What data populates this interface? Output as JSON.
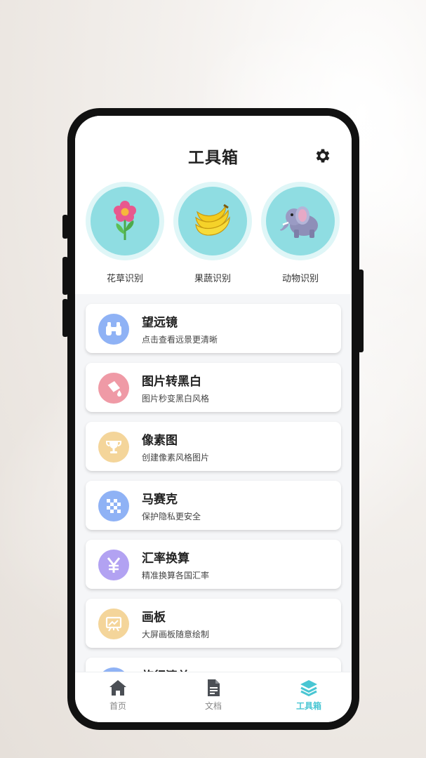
{
  "header": {
    "title": "工具箱"
  },
  "recognition": [
    {
      "label": "花草识别",
      "icon": "flower-icon"
    },
    {
      "label": "果蔬识别",
      "icon": "banana-icon"
    },
    {
      "label": "动物识别",
      "icon": "elephant-icon"
    }
  ],
  "tools": [
    {
      "title": "望远镜",
      "subtitle": "点击查看远景更清晰",
      "icon": "binoculars-icon",
      "color": "#8fb2f5"
    },
    {
      "title": "图片转黑白",
      "subtitle": "图片秒变黑白风格",
      "icon": "paint-bucket-icon",
      "color": "#ef9aa6"
    },
    {
      "title": "像素图",
      "subtitle": "创建像素风格图片",
      "icon": "trophy-icon",
      "color": "#f4d59a"
    },
    {
      "title": "马赛克",
      "subtitle": "保护隐私更安全",
      "icon": "mosaic-icon",
      "color": "#8fb2f5"
    },
    {
      "title": "汇率换算",
      "subtitle": "精准换算各国汇率",
      "icon": "yen-icon",
      "color": "#b2a2f2"
    },
    {
      "title": "画板",
      "subtitle": "大屏画板随意绘制",
      "icon": "easel-icon",
      "color": "#f4d59a"
    },
    {
      "title": "旅行清单",
      "subtitle": "",
      "icon": "checklist-icon",
      "color": "#8fb2f5"
    }
  ],
  "tabbar": [
    {
      "label": "首页",
      "icon": "home-icon"
    },
    {
      "label": "文档",
      "icon": "document-icon"
    },
    {
      "label": "工具箱",
      "icon": "layers-icon"
    }
  ],
  "colors": {
    "accent": "#49c6d3",
    "inactive": "#888888"
  }
}
